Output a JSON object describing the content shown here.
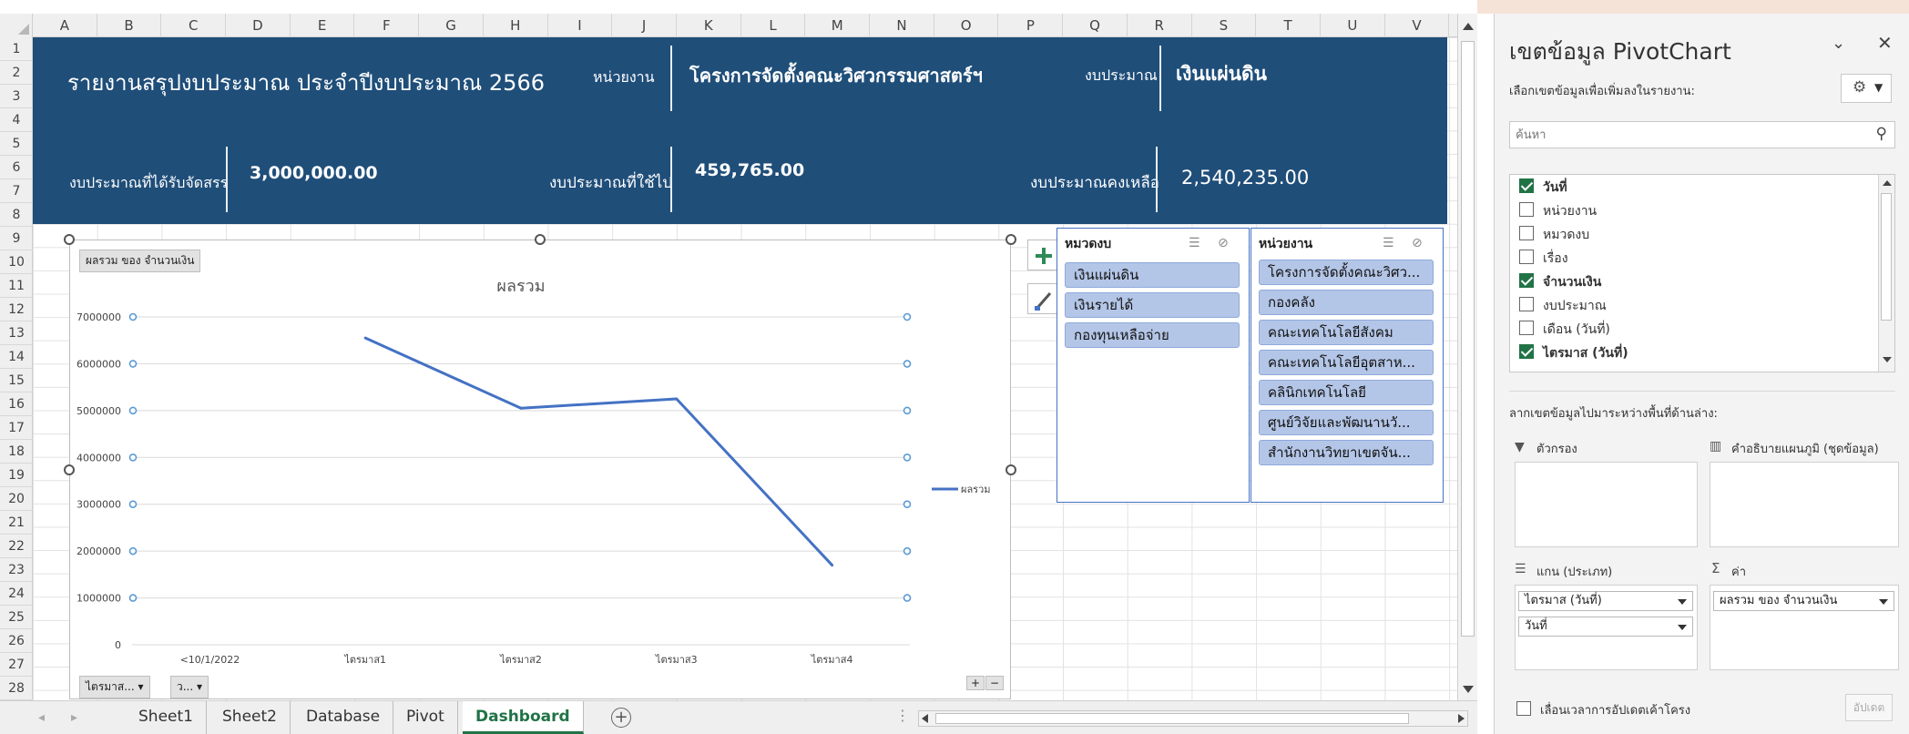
{
  "columns": [
    "A",
    "B",
    "C",
    "D",
    "E",
    "F",
    "G",
    "H",
    "I",
    "J",
    "K",
    "L",
    "M",
    "N",
    "O",
    "P",
    "Q",
    "R",
    "S",
    "T",
    "U",
    "V"
  ],
  "rows": [
    "1",
    "2",
    "3",
    "4",
    "5",
    "6",
    "7",
    "8",
    "9",
    "10",
    "11",
    "12",
    "13",
    "14",
    "15",
    "16",
    "17",
    "18",
    "19",
    "20",
    "21",
    "22",
    "23",
    "24",
    "25",
    "26",
    "27",
    "28"
  ],
  "banner": {
    "report_title": "รายงานสรุปงบประมาณ ประจำปีงบประมาณ 2566",
    "unit_label": "หน่วยงาน",
    "unit_value": "โครงการจัดตั้งคณะวิศวกรรมศาสตร์ฯ",
    "budget_type_label": "งบประมาณ",
    "budget_type_value": "เงินแผ่นดิน",
    "allocated_label": "งบประมาณที่ได้รับจัดสรร",
    "allocated_value": "3,000,000.00",
    "used_label": "งบประมาณที่ใช้ไป",
    "used_value": "459,765.00",
    "remaining_label": "งบประมาณคงเหลือ",
    "remaining_value": "2,540,235.00"
  },
  "chart_data": {
    "type": "line",
    "title": "ผลรวม",
    "value_field_button": "ผลรวม ของ จำนวนเงิน",
    "categories": [
      "<10/1/2022",
      "ไตรมาส1",
      "ไตรมาส2",
      "ไตรมาส3",
      "ไตรมาส4"
    ],
    "series": [
      {
        "name": "ผลรวม",
        "values": [
          null,
          6550000,
          5050000,
          5250000,
          1700000
        ],
        "color": "#4472c4"
      }
    ],
    "yticks": [
      "0",
      "1000000",
      "2000000",
      "3000000",
      "4000000",
      "5000000",
      "6000000",
      "7000000"
    ],
    "ylim": [
      0,
      7000000
    ],
    "grid": true,
    "legend": "right",
    "axis_buttons": [
      "ไตรมาส...",
      "ว..."
    ],
    "zoom_buttons": [
      "+",
      "−"
    ]
  },
  "slicers": [
    {
      "title": "หมวดงบ",
      "items": [
        "เงินแผ่นดิน",
        "เงินรายได้",
        "กองทุนเหลือจ่าย"
      ]
    },
    {
      "title": "หน่วยงาน",
      "items": [
        "โครงการจัดตั้งคณะวิศว...",
        "กองคลัง",
        "คณะเทคโนโลยีสังคม",
        "คณะเทคโนโลยีอุตสาห...",
        "คลินิกเทคโนโลยี",
        "ศูนย์วิจัยและพัฒนานวั...",
        "สำนักงานวิทยาเขตจัน..."
      ]
    }
  ],
  "tabs": [
    "Sheet1",
    "Sheet2",
    "Database",
    "Pivot",
    "Dashboard"
  ],
  "active_tab": "Dashboard",
  "pane": {
    "title": "เขตข้อมูล PivotChart",
    "subtitle": "เลือกเขตข้อมูลเพื่อเพิ่มลงในรายงาน:",
    "search_placeholder": "ค้นหา",
    "fields": [
      {
        "label": "วันที่",
        "checked": true
      },
      {
        "label": "หน่วยงาน",
        "checked": false
      },
      {
        "label": "หมวดงบ",
        "checked": false
      },
      {
        "label": "เรื่อง",
        "checked": false
      },
      {
        "label": "จำนวนเงิน",
        "checked": true
      },
      {
        "label": "งบประมาณ",
        "checked": false
      },
      {
        "label": "เดือน (วันที่)",
        "checked": false
      },
      {
        "label": "ไตรมาส (วันที่)",
        "checked": true
      }
    ],
    "drag_hint": "ลากเขตข้อมูลไปมาระหว่างพื้นที่ด้านล่าง:",
    "filters_label": "ตัวกรอง",
    "legend_label": "คำอธิบายแผนภูมิ (ชุดข้อมูล)",
    "axis_label": "แกน (ประเภท)",
    "values_label": "ค่า",
    "axis_items": [
      "ไตรมาส (วันที่)",
      "วันที่"
    ],
    "value_items": [
      "ผลรวม ของ จำนวนเงิน"
    ],
    "defer_label": "เลื่อนเวลาการอัปเดตเค้าโครง",
    "update_button": "อัปเดต"
  }
}
